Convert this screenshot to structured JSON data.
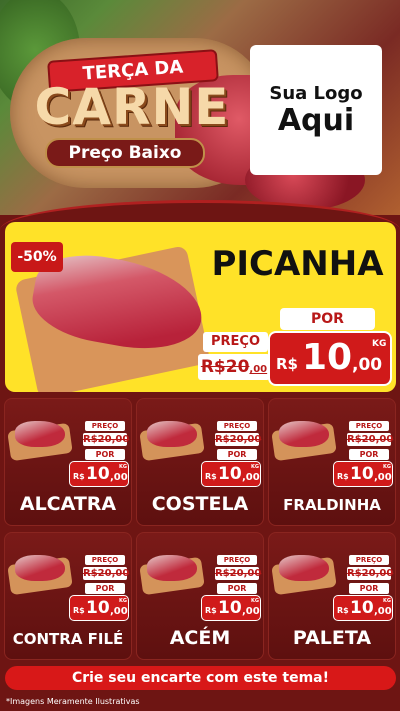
{
  "header": {
    "ribbon": "TERÇA DA",
    "title": "CARNE",
    "subtitle": "Preço Baixo",
    "logo_line1": "Sua Logo",
    "logo_line2": "Aqui"
  },
  "featured": {
    "discount": "-50%",
    "name": "PICANHA",
    "preco_label": "PREÇO",
    "old_price_int": "R$20",
    "old_price_dec": ",00",
    "por_label": "POR",
    "currency": "R$",
    "new_price_int": "10",
    "new_price_dec": ",00",
    "unit": "KG"
  },
  "products": [
    {
      "name": "ALCATRA",
      "preco_label": "PREÇO",
      "old_price": "R$20,00",
      "por_label": "POR",
      "currency": "R$",
      "new_price_int": "10",
      "new_price_dec": ",00",
      "unit": "KG"
    },
    {
      "name": "COSTELA",
      "preco_label": "PREÇO",
      "old_price": "R$20,00",
      "por_label": "POR",
      "currency": "R$",
      "new_price_int": "10",
      "new_price_dec": ",00",
      "unit": "KG"
    },
    {
      "name": "FRALDINHA",
      "preco_label": "PREÇO",
      "old_price": "R$20,00",
      "por_label": "POR",
      "currency": "R$",
      "new_price_int": "10",
      "new_price_dec": ",00",
      "unit": "KG"
    },
    {
      "name": "CONTRA FILÉ",
      "preco_label": "PREÇO",
      "old_price": "R$20,00",
      "por_label": "POR",
      "currency": "R$",
      "new_price_int": "10",
      "new_price_dec": ",00",
      "unit": "KG"
    },
    {
      "name": "ACÉM",
      "preco_label": "PREÇO",
      "old_price": "R$20,00",
      "por_label": "POR",
      "currency": "R$",
      "new_price_int": "10",
      "new_price_dec": ",00",
      "unit": "KG"
    },
    {
      "name": "PALETA",
      "preco_label": "PREÇO",
      "old_price": "R$20,00",
      "por_label": "POR",
      "currency": "R$",
      "new_price_int": "10",
      "new_price_dec": ",00",
      "unit": "KG"
    }
  ],
  "cta": "Crie seu encarte com este tema!",
  "footnote": "*Imagens Meramente Ilustrativas",
  "colors": {
    "background": "#6e1513",
    "featured_bg": "#ffe228",
    "price_red": "#d01a1a",
    "cta_red": "#d81818"
  }
}
